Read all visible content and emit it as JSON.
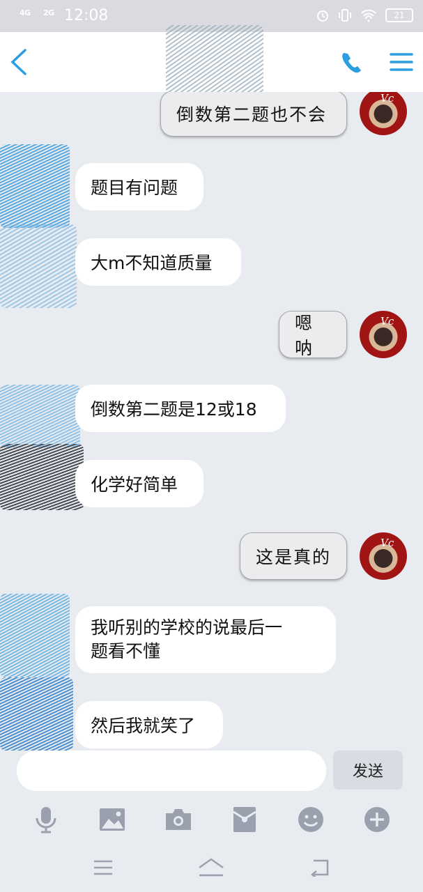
{
  "status_bar": {
    "signal_1": "4G",
    "signal_2": "2G",
    "time": "12:08",
    "battery": "21"
  },
  "header": {
    "back_icon": "chevron-left-icon",
    "call_icon": "phone-icon",
    "menu_icon": "hamburger-menu-icon"
  },
  "messages": [
    {
      "side": "sent",
      "text": "倒数第二题也不会"
    },
    {
      "side": "received",
      "text": "题目有问题"
    },
    {
      "side": "received",
      "text": "大m不知道质量"
    },
    {
      "side": "sent",
      "text": "嗯呐"
    },
    {
      "side": "received",
      "text": "倒数第二题是12或18"
    },
    {
      "side": "received",
      "text": "化学好简单"
    },
    {
      "side": "sent",
      "text": "这是真的"
    },
    {
      "side": "received",
      "line1": "我听别的学校的说最后一",
      "line2": "题看不懂"
    },
    {
      "side": "received",
      "text": "然后我就笑了"
    }
  ],
  "input": {
    "value": "",
    "placeholder": "",
    "send_label": "发送"
  },
  "toolbar": [
    "microphone-icon",
    "image-icon",
    "camera-icon",
    "red-packet-icon",
    "emoji-icon",
    "plus-icon"
  ],
  "navbar": [
    "menu-icon",
    "home-icon",
    "back-icon"
  ],
  "colors": {
    "accent": "#2a9ee0",
    "chat_background": "#e8ebf0",
    "icon_gray": "#9aa0ad"
  }
}
